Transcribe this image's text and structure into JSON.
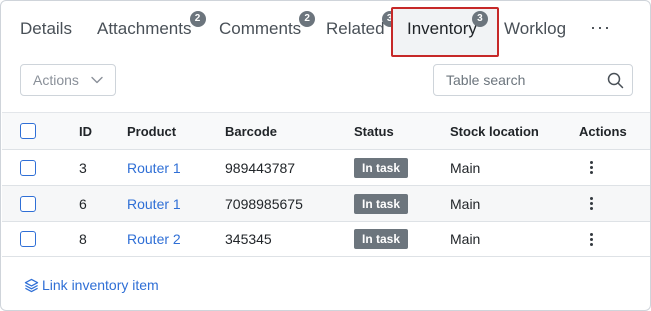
{
  "tabs": [
    {
      "label": "Details"
    },
    {
      "label": "Attachments",
      "badge": "2"
    },
    {
      "label": "Comments",
      "badge": "2"
    },
    {
      "label": "Related",
      "badge": "3"
    },
    {
      "label": "Inventory",
      "badge": "3",
      "active": true
    },
    {
      "label": "Worklog"
    }
  ],
  "more_label": "···",
  "toolbar": {
    "actions_label": "Actions",
    "search_placeholder": "Table search"
  },
  "table": {
    "columns": [
      "ID",
      "Product",
      "Barcode",
      "Status",
      "Stock location",
      "Actions"
    ],
    "rows": [
      {
        "id": "3",
        "product": "Router 1",
        "barcode": "989443787",
        "status": "In task",
        "location": "Main"
      },
      {
        "id": "6",
        "product": "Router 1",
        "barcode": "7098985675",
        "status": "In task",
        "location": "Main"
      },
      {
        "id": "8",
        "product": "Router 2",
        "barcode": "345345",
        "status": "In task",
        "location": "Main"
      }
    ]
  },
  "footer": {
    "link_inventory_label": "Link inventory item"
  },
  "icons": {
    "more": "more-horizontal-icon",
    "chevron": "chevron-down-icon",
    "search": "search-icon",
    "kebab": "kebab-menu-icon",
    "layers": "layers-icon"
  },
  "colors": {
    "accent": "#2f6fd6",
    "badge": "#6c757d",
    "active_outline": "#c62828"
  }
}
